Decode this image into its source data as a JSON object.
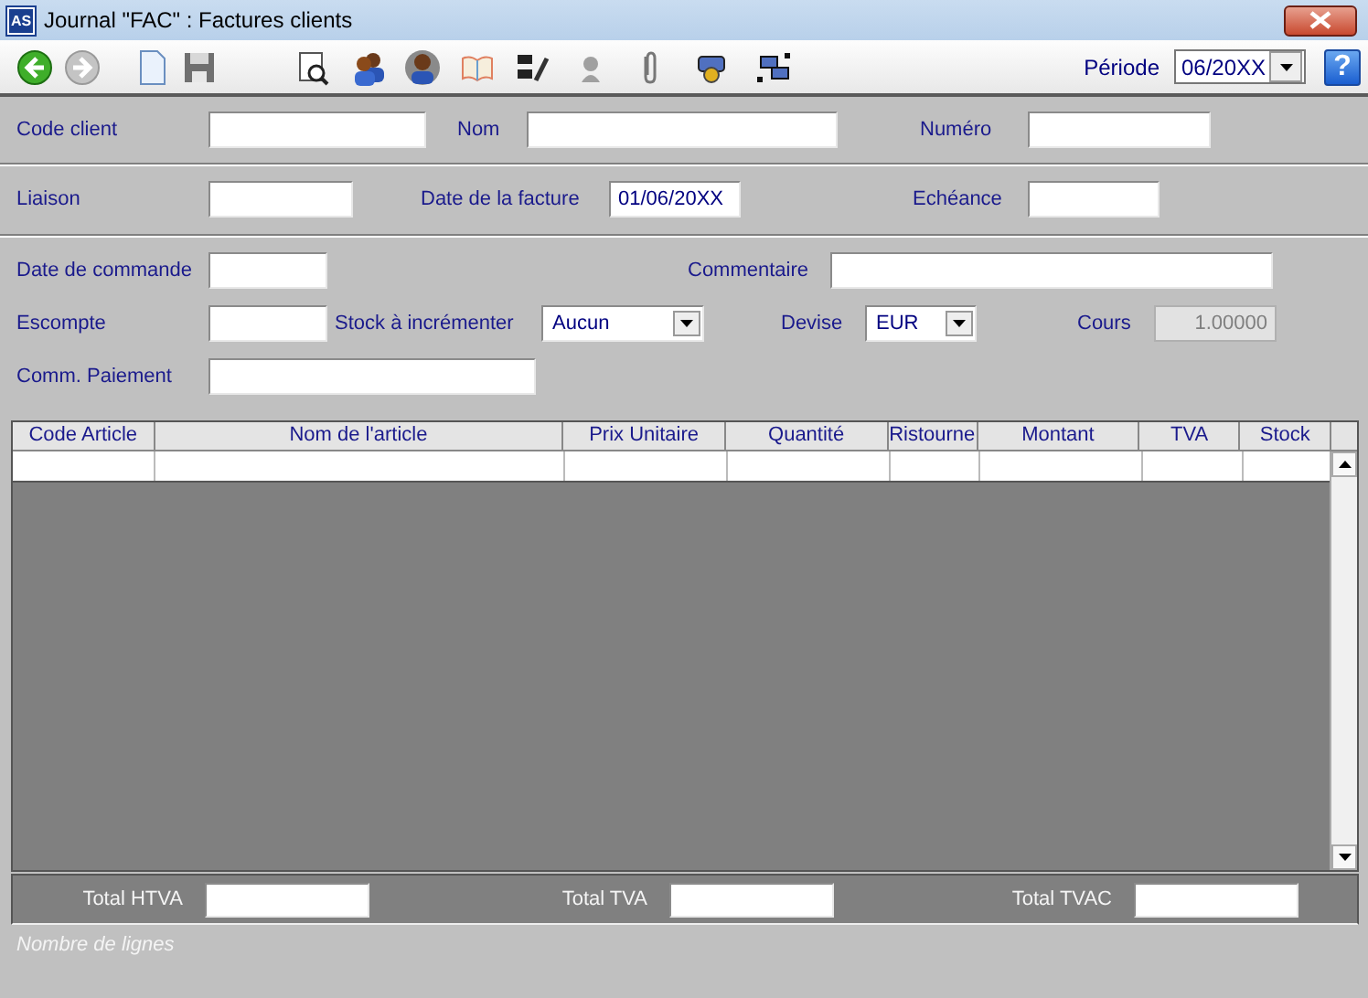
{
  "window": {
    "logo": "AS",
    "title": "Journal \"FAC\" : Factures clients"
  },
  "toolbar": {
    "period_label": "Période",
    "period": "06/20XX",
    "help": "?"
  },
  "form": {
    "sections": [
      [
        {
          "label": "Code client",
          "kind": "text",
          "disabled": false
        },
        {
          "label": "Nom",
          "kind": "text",
          "disabled": false
        },
        {
          "label": "Numéro",
          "kind": "text",
          "disabled": false
        }
      ],
      [
        {
          "label": "Liaison",
          "kind": "text",
          "disabled": false
        },
        {
          "label": "Date de la facture",
          "value": "01/06/20XX",
          "kind": "text",
          "disabled": false
        },
        {
          "label": "Echéance",
          "kind": "text",
          "disabled": false
        }
      ],
      [
        {
          "label": "Date de commande",
          "kind": "text",
          "disabled": false
        },
        {
          "label": "Commentaire",
          "kind": "text",
          "disabled": false
        },
        {
          "label": "Escompte",
          "kind": "text",
          "disabled": false
        },
        {
          "label": "Stock à incrémenter",
          "value": "Aucun",
          "kind": "select",
          "disabled": false
        },
        {
          "label": "Devise",
          "value": "EUR",
          "kind": "select",
          "disabled": false
        },
        {
          "label": "Cours",
          "value": "1.00000",
          "kind": "text",
          "disabled": true
        },
        {
          "label": "Comm. Paiement",
          "kind": "text",
          "disabled": false
        }
      ]
    ]
  },
  "table": {
    "columns": [
      "Code Article",
      "Nom de l'article",
      "Prix Unitaire",
      "Quantité",
      "Ristourne",
      "Montant",
      "TVA",
      "Stock"
    ]
  },
  "totals": [
    {
      "label": "Total HTVA"
    },
    {
      "label": "Total TVA"
    },
    {
      "label": "Total TVAC"
    }
  ],
  "status_bar": "Nombre de lignes"
}
